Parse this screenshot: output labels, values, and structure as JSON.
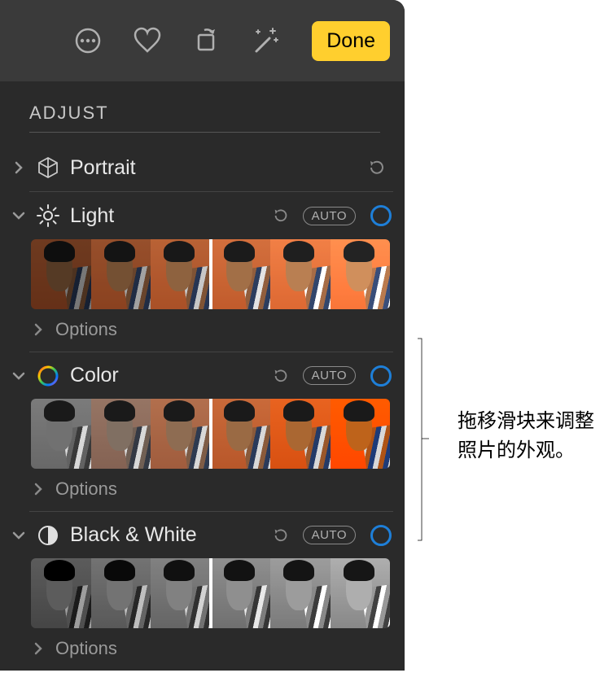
{
  "toolbar": {
    "done_label": "Done"
  },
  "section": {
    "title": "ADJUST"
  },
  "rows": {
    "portrait": {
      "label": "Portrait"
    },
    "light": {
      "label": "Light",
      "auto": "AUTO",
      "options": "Options"
    },
    "color": {
      "label": "Color",
      "auto": "AUTO",
      "options": "Options"
    },
    "bw": {
      "label": "Black & White",
      "auto": "AUTO",
      "options": "Options"
    }
  },
  "callout": {
    "line1": "拖移滑块来调整",
    "line2": "照片的外观。"
  },
  "icons": {
    "more": "more-icon",
    "favorite": "heart-icon",
    "rotate": "rotate-crop-icon",
    "enhance": "enhance-wand-icon",
    "cube": "cube-icon",
    "light": "light-sun-icon",
    "color": "color-ring-icon",
    "bw": "half-circle-icon",
    "reset": "reset-arrow-icon"
  }
}
